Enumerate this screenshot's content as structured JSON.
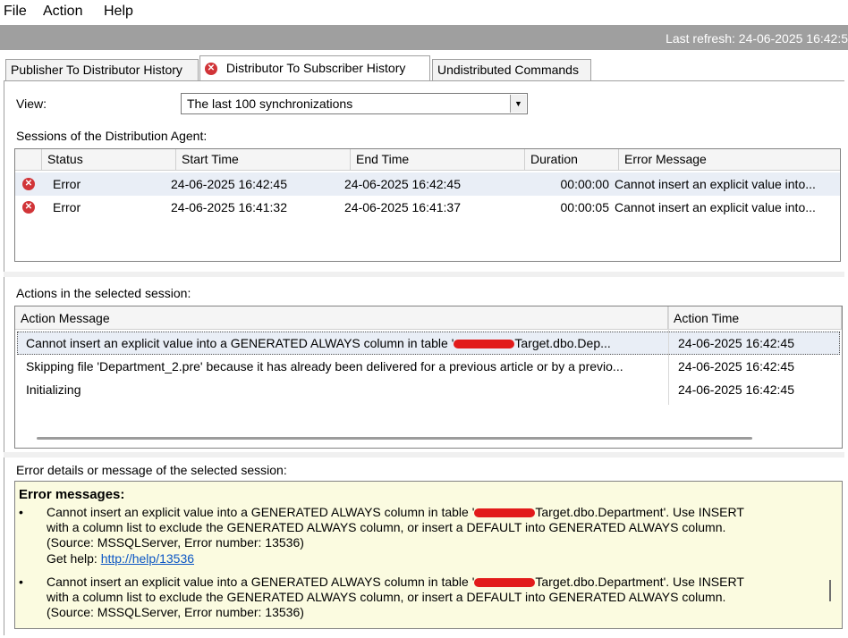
{
  "menu": {
    "file": "File",
    "action": "Action",
    "help": "Help"
  },
  "refresh": {
    "text": "Last refresh: 24-06-2025 16:42:5"
  },
  "tabs": [
    {
      "label": "Publisher To Distributor History"
    },
    {
      "label": "Distributor To Subscriber History"
    },
    {
      "label": "Undistributed Commands"
    }
  ],
  "view": {
    "label": "View:",
    "selected": "The last 100 synchronizations"
  },
  "sessions": {
    "label": "Sessions of the Distribution Agent:",
    "columns": [
      "Status",
      "Start Time",
      "End Time",
      "Duration",
      "Error Message"
    ],
    "rows": [
      {
        "status": "Error",
        "start": "24-06-2025 16:42:45",
        "end": "24-06-2025 16:42:45",
        "duration": "00:00:00",
        "message": "Cannot insert an explicit value into..."
      },
      {
        "status": "Error",
        "start": "24-06-2025 16:41:32",
        "end": "24-06-2025 16:41:37",
        "duration": "00:00:05",
        "message": "Cannot insert an explicit value into..."
      }
    ]
  },
  "actions": {
    "label": "Actions in the selected session:",
    "columns": [
      "Action Message",
      "Action Time"
    ],
    "rows": [
      {
        "message_pre": "Cannot insert an explicit value into a GENERATED ALWAYS column in table '",
        "message_post": "Target.dbo.Dep...",
        "time": "24-06-2025 16:42:45"
      },
      {
        "message": "Skipping file 'Department_2.pre' because it has already been delivered for a previous article or by a previo...",
        "time": "24-06-2025 16:42:45"
      },
      {
        "message": "Initializing",
        "time": "24-06-2025 16:42:45"
      }
    ]
  },
  "details": {
    "label": "Error details or message of the selected session:",
    "title": "Error messages:",
    "bullet": "•",
    "entries": [
      {
        "line1_pre": "Cannot insert an explicit value into a GENERATED ALWAYS column in table '",
        "line1_post": "Target.dbo.Department'. Use INSERT",
        "line2": "with a column list to exclude the GENERATED ALWAYS column, or insert a DEFAULT into GENERATED ALWAYS column.",
        "line3": "(Source: MSSQLServer, Error number: 13536)",
        "help_label": "Get help: ",
        "help_link": "http://help/13536"
      },
      {
        "line1_pre": "Cannot insert an explicit value into a GENERATED ALWAYS column in table '",
        "line1_post": "Target.dbo.Department'. Use INSERT",
        "line2": "with a column list to exclude the GENERATED ALWAYS column, or insert a DEFAULT into GENERATED ALWAYS column.",
        "line3": "(Source: MSSQLServer, Error number: 13536)"
      }
    ]
  },
  "colors": {
    "error_red": "#d13438",
    "refresh_bar": "#9f9f9f",
    "detail_bg": "#fbfbe0",
    "link": "#0b56c4"
  }
}
